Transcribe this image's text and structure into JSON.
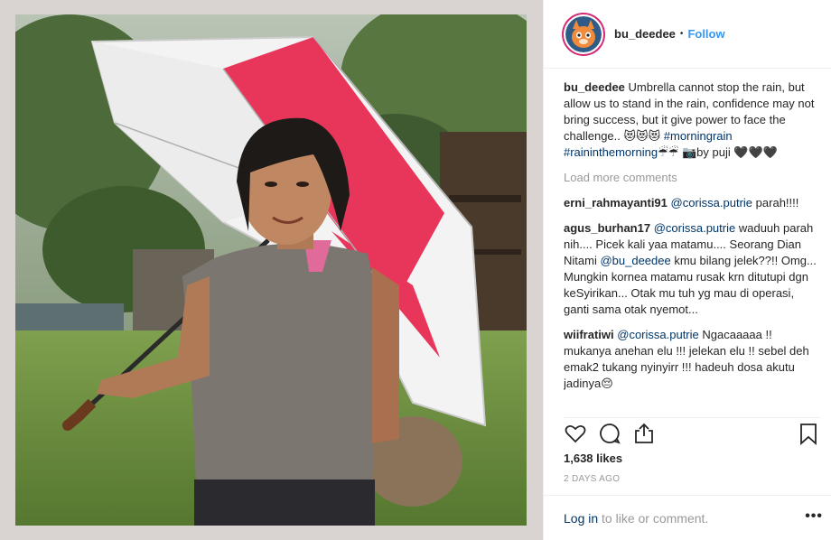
{
  "post": {
    "username": "bu_deedee",
    "follow_label": "Follow",
    "separator": "•"
  },
  "caption": {
    "username": "bu_deedee",
    "text": "Umbrella cannot stop the rain, but allow us to stand in the rain, confidence may not bring success, but it give power to face the challenge.. 😻😻😻 ",
    "hashtag1": "#morningrain",
    "hashtag2": "#raininthemorning",
    "tail": "☔☔ 📷by puji 🖤🖤🖤"
  },
  "load_more_label": "Load more comments",
  "comments": [
    {
      "username": "erni_rahmayanti91",
      "mention": "@corissa.putrie",
      "text": "parah!!!!"
    },
    {
      "username": "agus_burhan17",
      "mention": "@corissa.putrie",
      "text_a": " waduuh parah nih.... Picek kali yaa matamu.... Seorang Dian Nitami ",
      "mention2": "@bu_deedee",
      "text_b": " kmu bilang jelek??!! Omg... Mungkin kornea matamu rusak krn ditutupi dgn keSyirikan... Otak mu tuh yg mau di operasi, ganti sama otak nyemot..."
    },
    {
      "username": "wiifratiwi",
      "mention": "@corissa.putrie",
      "text": " Ngacaaaaa !! mukanya anehan elu !!! jelekan elu !! sebel deh emak2 tukang nyinyirr !!! hadeuh dosa akutu jadinya😔"
    }
  ],
  "likes_label": "1,638 likes",
  "timestamp": "2 DAYS AGO",
  "footer": {
    "login_label": "Log in",
    "rest": " to like or comment.",
    "more": "•••"
  },
  "icons": {
    "like": "heart-icon",
    "comment": "comment-icon",
    "share": "share-icon",
    "save": "bookmark-icon",
    "avatar": "cat-avatar"
  },
  "colors": {
    "link": "#003569",
    "follow": "#3897f0",
    "muted": "#999999",
    "umbrella_red": "#e8365b"
  }
}
